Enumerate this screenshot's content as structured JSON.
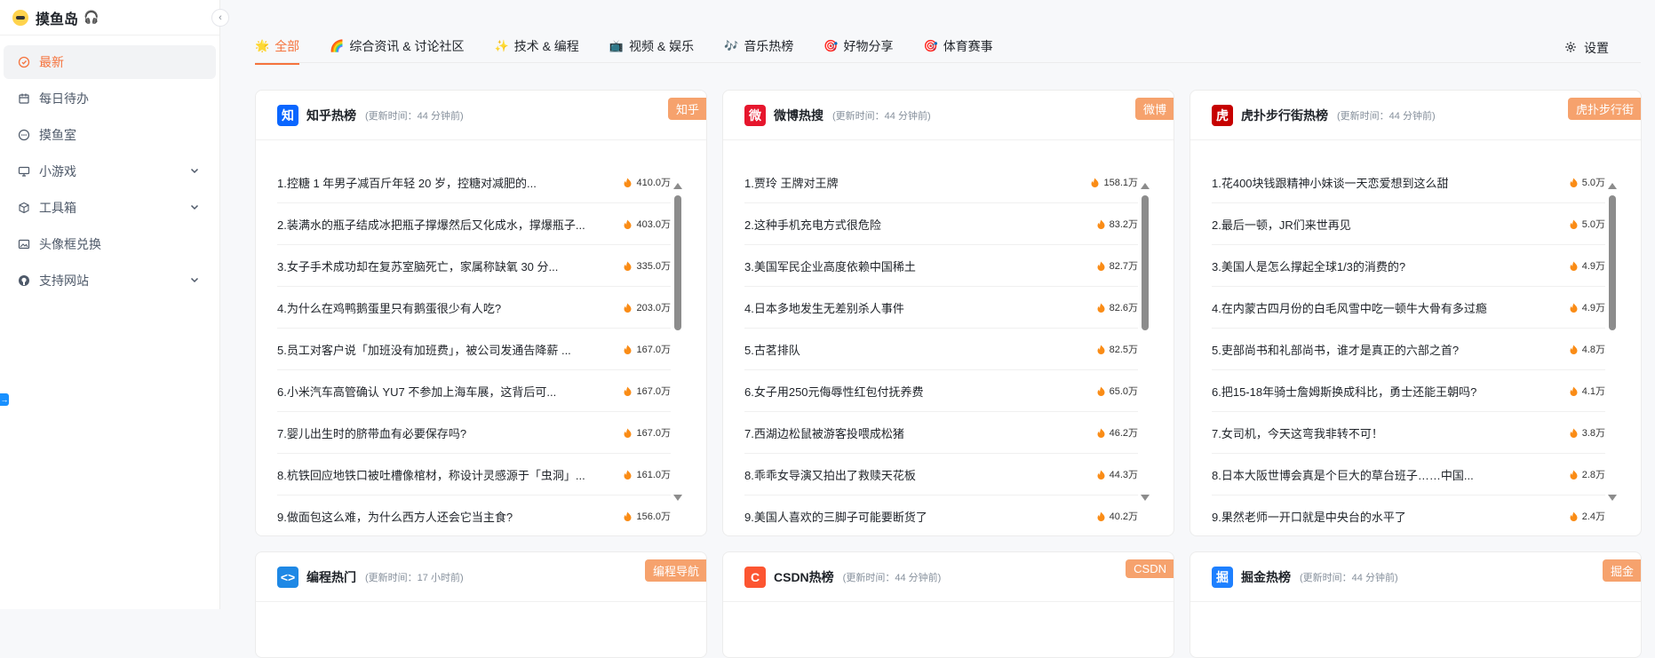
{
  "sidebar": {
    "brand": {
      "name": "摸鱼岛",
      "emoji": "🎧"
    },
    "items": [
      {
        "label": "最新",
        "icon": "clock-icon",
        "active": true
      },
      {
        "label": "每日待办",
        "icon": "calendar-icon"
      },
      {
        "label": "摸鱼室",
        "icon": "chat-icon"
      },
      {
        "label": "小游戏",
        "icon": "monitor-icon",
        "expandable": true
      },
      {
        "label": "工具箱",
        "icon": "box-icon",
        "expandable": true
      },
      {
        "label": "头像框兑换",
        "icon": "image-icon"
      },
      {
        "label": "支持网站",
        "icon": "github-icon",
        "expandable": true
      }
    ]
  },
  "tabs": [
    {
      "label": "全部",
      "emoji": "🌟",
      "active": true
    },
    {
      "label": "综合资讯 & 讨论社区",
      "emoji": "🌈"
    },
    {
      "label": "技术 & 编程",
      "emoji": "✨"
    },
    {
      "label": "视频 & 娱乐",
      "emoji": "📺"
    },
    {
      "label": "音乐热榜",
      "emoji": "🎶"
    },
    {
      "label": "好物分享",
      "emoji": "🎯"
    },
    {
      "label": "体育赛事",
      "emoji": "🎯"
    }
  ],
  "settings_label": "设置",
  "cards": [
    {
      "title": "知乎热榜",
      "updated": "(更新时间：44 分钟前)",
      "ribbon": "知乎",
      "logo_text": "知",
      "logo_color": "#0a66ff",
      "items": [
        {
          "title": "1.控糖 1 年男子减百斤年轻 20 岁，控糖对减肥的...",
          "heat": "410.0万"
        },
        {
          "title": "2.装满水的瓶子结成冰把瓶子撑爆然后又化成水，撑爆瓶子...",
          "heat": "403.0万"
        },
        {
          "title": "3.女子手术成功却在复苏室脑死亡，家属称缺氧 30 分...",
          "heat": "335.0万"
        },
        {
          "title": "4.为什么在鸡鸭鹅蛋里只有鹅蛋很少有人吃?",
          "heat": "203.0万"
        },
        {
          "title": "5.员工对客户说「加班没有加班费」，被公司发通告降薪 ...",
          "heat": "167.0万"
        },
        {
          "title": "6.小米汽车高管确认 YU7 不参加上海车展，这背后可...",
          "heat": "167.0万"
        },
        {
          "title": "7.婴儿出生时的脐带血有必要保存吗?",
          "heat": "167.0万"
        },
        {
          "title": "8.杭铁回应地铁口被吐槽像棺材，称设计灵感源于「虫洞」...",
          "heat": "161.0万"
        },
        {
          "title": "9.做面包这么难，为什么西方人还会它当主食?",
          "heat": "156.0万"
        }
      ]
    },
    {
      "title": "微博热搜",
      "updated": "(更新时间：44 分钟前)",
      "ribbon": "微博",
      "logo_text": "微",
      "logo_color": "#e6162d",
      "items": [
        {
          "title": "1.贾玲 王牌对王牌",
          "heat": "158.1万"
        },
        {
          "title": "2.这种手机充电方式很危险",
          "heat": "83.2万"
        },
        {
          "title": "3.美国军民企业高度依赖中国稀土",
          "heat": "82.7万"
        },
        {
          "title": "4.日本多地发生无差别杀人事件",
          "heat": "82.6万"
        },
        {
          "title": "5.古茗排队",
          "heat": "82.5万"
        },
        {
          "title": "6.女子用250元侮辱性红包付抚养费",
          "heat": "65.0万"
        },
        {
          "title": "7.西湖边松鼠被游客投喂成松猪",
          "heat": "46.2万"
        },
        {
          "title": "8.乖乖女导演又拍出了救赎天花板",
          "heat": "44.3万"
        },
        {
          "title": "9.美国人喜欢的三脚子可能要断货了",
          "heat": "40.2万"
        }
      ]
    },
    {
      "title": "虎扑步行街热榜",
      "updated": "(更新时间：44 分钟前)",
      "ribbon": "虎扑步行街",
      "logo_text": "虎",
      "logo_color": "#c60100",
      "items": [
        {
          "title": "1.花400块钱跟精神小妹谈一天恋爱想到这么甜",
          "heat": "5.0万"
        },
        {
          "title": "2.最后一顿，JR们来世再见",
          "heat": "5.0万"
        },
        {
          "title": "3.美国人是怎么撑起全球1/3的消费的?",
          "heat": "4.9万"
        },
        {
          "title": "4.在内蒙古四月份的白毛风雪中吃一顿牛大骨有多过瘾",
          "heat": "4.9万"
        },
        {
          "title": "5.吏部尚书和礼部尚书，谁才是真正的六部之首?",
          "heat": "4.8万"
        },
        {
          "title": "6.把15-18年骑士詹姆斯换成科比，勇士还能王朝吗?",
          "heat": "4.1万"
        },
        {
          "title": "7.女司机，今天这弯我非转不可！",
          "heat": "3.8万"
        },
        {
          "title": "8.日本大阪世博会真是个巨大的草台班子……中国...",
          "heat": "2.8万"
        },
        {
          "title": "9.果然老师一开口就是中央台的水平了",
          "heat": "2.4万"
        }
      ]
    },
    {
      "title": "编程热门",
      "updated": "(更新时间：17 小时前)",
      "ribbon": "编程导航",
      "logo_text": "<>",
      "logo_color": "#1e88e5"
    },
    {
      "title": "CSDN热榜",
      "updated": "(更新时间：44 分钟前)",
      "ribbon": "CSDN",
      "logo_text": "C",
      "logo_color": "#fc5531"
    },
    {
      "title": "掘金热榜",
      "updated": "(更新时间：44 分钟前)",
      "ribbon": "掘金",
      "logo_text": "掘",
      "logo_color": "#1e80ff"
    }
  ]
}
